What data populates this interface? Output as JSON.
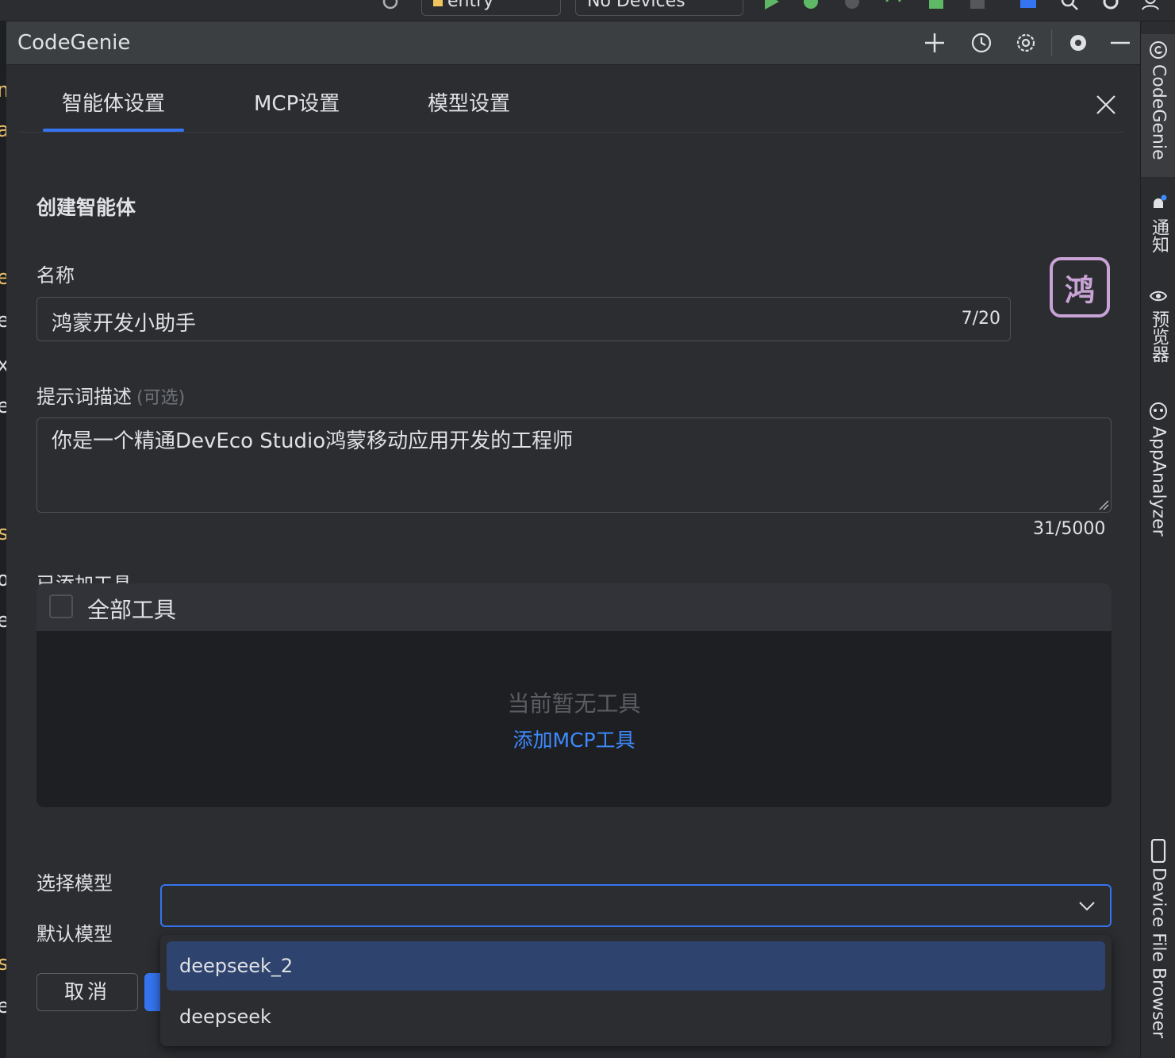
{
  "toolbar": {
    "module_selector": "entry",
    "device_selector": "No Devices"
  },
  "editor_strip": {
    "chars": [
      "n",
      "a",
      "e",
      "e",
      "x",
      "e",
      "s",
      "o",
      "e",
      "s",
      "e"
    ]
  },
  "right_bar": {
    "items": [
      "CodeGenie",
      "通知",
      "预览器",
      "AppAnalyzer",
      "Device File Browser"
    ]
  },
  "panel": {
    "title": "CodeGenie"
  },
  "tabs": [
    "智能体设置",
    "MCP设置",
    "模型设置"
  ],
  "form": {
    "section_title": "创建智能体",
    "name_label": "名称",
    "name_value": "鸿蒙开发小助手",
    "name_counter": "7/20",
    "avatar_char": "鸿",
    "prompt_label": "提示词描述",
    "prompt_optional": "(可选)",
    "prompt_value": "你是一个精通DevEco Studio鸿蒙移动应用开发的工程师",
    "prompt_counter": "31/5000",
    "tools_label": "已添加工具",
    "all_tools_label": "全部工具",
    "no_tools_text": "当前暂无工具",
    "add_mcp_link": "添加MCP工具",
    "model_section": "选择模型",
    "default_model_label": "默认模型",
    "model_value": "",
    "model_options": [
      "deepseek_2",
      "deepseek"
    ],
    "selected_option": "deepseek_2",
    "cancel_button": "取消"
  },
  "colors": {
    "accent": "#3574f0",
    "link": "#3d8bff",
    "avatar": "#c9a3d6",
    "background": "#2b2d30"
  }
}
